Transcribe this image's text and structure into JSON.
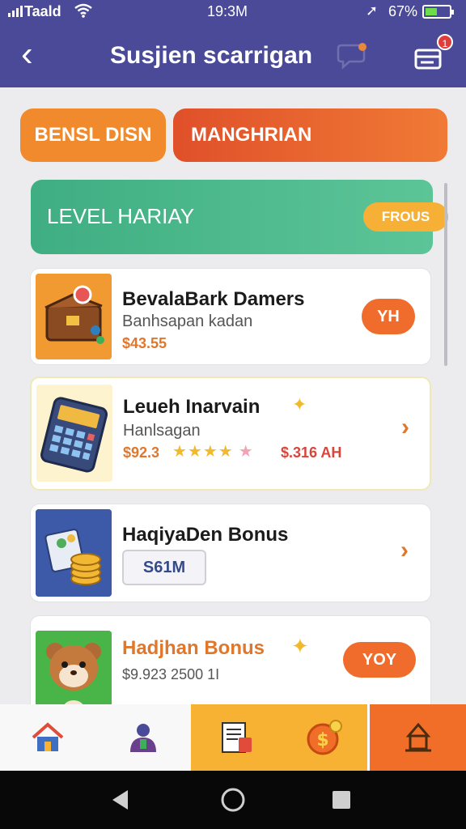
{
  "status_bar": {
    "carrier": "Taald",
    "time": "19:3M",
    "battery": "67%",
    "location_icon": "navigation-arrow-icon"
  },
  "header": {
    "title": "Susjien scarrigan",
    "cart_badge": "1",
    "icons": [
      "back-chevron-icon",
      "chat-bubble-icon",
      "cart-icon"
    ]
  },
  "tabs": [
    {
      "label": "BENSL DISN"
    },
    {
      "label": "MANGHRIAN"
    }
  ],
  "level_banner": {
    "label": "LEVEL HARIAY",
    "button": "FROUS"
  },
  "cards": [
    {
      "name": "BevalaBark Damers",
      "subtitle": "Banhsapan kadan",
      "price": "$43.55",
      "cta": "YH",
      "icon": "treasure-chest-icon"
    },
    {
      "name": "Leueh Inarvain",
      "subtitle": "Hanlsagan",
      "price": "$92.3",
      "rating_stars": 4,
      "alt_price": "$.316 AH",
      "icon": "calculator-icon"
    },
    {
      "name": "HaqiyaDen Bonus",
      "field_value": "S61M",
      "icon": "coin-stack-icon"
    },
    {
      "name": "Hadjhan Bonus",
      "price": "$9.923  2500 1I",
      "cta": "YOY",
      "icon": "hamster-mascot-icon"
    }
  ],
  "bottom_nav": [
    "home-icon",
    "user-icon",
    "document-icon",
    "coin-icon",
    "shop-icon"
  ],
  "colors": {
    "header": "#4a4a98",
    "accent_orange": "#ef6c2d",
    "level_green": "#3fae82",
    "gold": "#f7b233"
  }
}
